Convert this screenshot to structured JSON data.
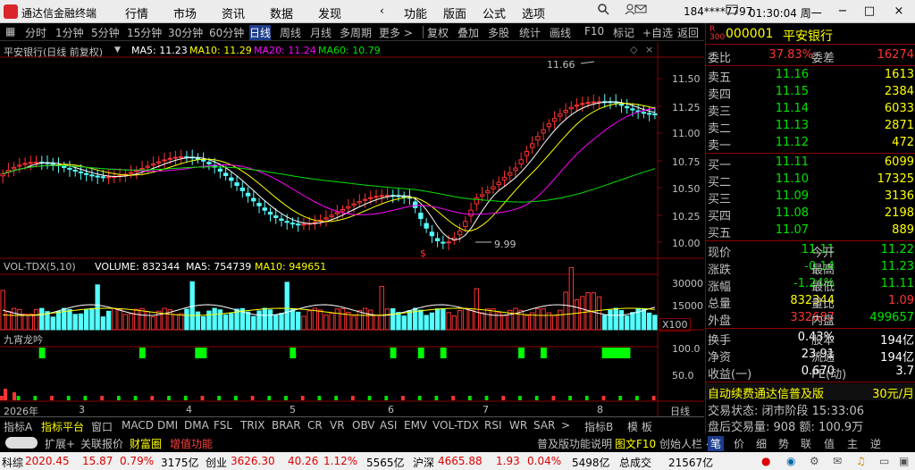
{
  "titlebar": {
    "app_name": "通达信金融终端",
    "menus": [
      "行情",
      "市场",
      "资讯",
      "数据",
      "发现",
      "功能",
      "版面",
      "公式",
      "选项"
    ],
    "account": "184****7797",
    "time": "01:30:04 周一",
    "back_arrow": "‹"
  },
  "toolbar": {
    "periods": [
      "分时",
      "1分钟",
      "5分钟",
      "15分钟",
      "30分钟",
      "60分钟",
      "日线",
      "周线",
      "月线",
      "多周期",
      "更多 >"
    ],
    "active": "日线",
    "right": [
      "复权",
      "叠加",
      "多股",
      "统计",
      "画线",
      "F10",
      "标记",
      "+自选",
      "返回"
    ]
  },
  "main_chart": {
    "header_name": "平安银行(日线 前复权)",
    "ma5": "MA5: 11.23",
    "ma10": "MA10: 11.29",
    "ma20": "MA20: 11.24",
    "ma60": "MA60: 10.79",
    "high_label": "11.66",
    "low_label": "9.99",
    "y_ticks": [
      "11.50",
      "11.25",
      "11.00",
      "10.75",
      "10.50",
      "10.25",
      "10.00"
    ]
  },
  "volume_chart": {
    "header": "VOL-TDX(5,10)",
    "volume": "VOLUME: 832344",
    "ma5": "MA5: 754739",
    "ma10": "MA10: 949651",
    "y_ticks": [
      "30000",
      "15000"
    ],
    "unit": "X100"
  },
  "indicator": {
    "name": "九宵龙吟",
    "y_ticks": [
      "100.0",
      "50.0"
    ]
  },
  "date_axis": {
    "year": "2026年",
    "months": [
      "3",
      "4",
      "5",
      "6",
      "7",
      "8"
    ],
    "period_label": "日线"
  },
  "bottom_tabs": [
    "指标A",
    "指标平台",
    "窗口",
    "MACD",
    "DMI",
    "DMA",
    "FSL",
    "TRIX",
    "BRAR",
    "CR",
    "VR",
    "OBV",
    "ASI",
    "EMV",
    "VOL-TDX",
    "RSI",
    "WR",
    "SAR",
    ">",
    "指标B",
    "模 板"
  ],
  "row2": {
    "left": [
      "扩展+",
      "关联报价",
      "财富圈",
      "增值功能"
    ],
    "right": [
      "普及版功能说明",
      "图文F10",
      "创始人栏 «"
    ],
    "icons": [
      "笔",
      "价",
      "细",
      "势",
      "联",
      "值",
      "主",
      "逆"
    ]
  },
  "quote": {
    "code": "000001",
    "name": "平安银行",
    "weibi_label": "委比",
    "weibi": "37.83%",
    "weicha_label": "委差",
    "weicha": "16274",
    "asks": [
      {
        "label": "卖五",
        "price": "11.16",
        "vol": "1613"
      },
      {
        "label": "卖四",
        "price": "11.15",
        "vol": "2384"
      },
      {
        "label": "卖三",
        "price": "11.14",
        "vol": "6033"
      },
      {
        "label": "卖二",
        "price": "11.13",
        "vol": "2871"
      },
      {
        "label": "卖一",
        "price": "11.12",
        "vol": "472"
      }
    ],
    "bids": [
      {
        "label": "买一",
        "price": "11.11",
        "vol": "6099"
      },
      {
        "label": "买二",
        "price": "11.10",
        "vol": "17325"
      },
      {
        "label": "买三",
        "price": "11.09",
        "vol": "3136"
      },
      {
        "label": "买四",
        "price": "11.08",
        "vol": "2198"
      },
      {
        "label": "买五",
        "price": "11.07",
        "vol": "889"
      }
    ],
    "stats": [
      {
        "l": "现价",
        "v": "11.11",
        "l2": "今开",
        "v2": "11.22"
      },
      {
        "l": "涨跌",
        "v": "-0.14",
        "l2": "最高",
        "v2": "11.23"
      },
      {
        "l": "涨幅",
        "v": "-1.24%",
        "l2": "最低",
        "v2": "11.11"
      },
      {
        "l": "总量",
        "v": "832344",
        "l2": "量比",
        "v2": "1.09"
      },
      {
        "l": "外盘",
        "v": "332687",
        "l2": "内盘",
        "v2": "499657"
      }
    ],
    "stats2": [
      {
        "l": "换手",
        "v": "0.43%",
        "l2": "股本",
        "v2": "194亿"
      },
      {
        "l": "净资",
        "v": "23.91",
        "l2": "流通",
        "v2": "194亿"
      },
      {
        "l": "收益(一)",
        "v": "0.670",
        "l2": "PE(动)",
        "v2": "3.7"
      }
    ],
    "ad_text": "自动续费通达信普及版",
    "ad_price": "30元/月",
    "trade_state": "交易状态: 闭市阶段 15:33:06",
    "after_hours": "盘后交易量: 908 额: 100.9万"
  },
  "status_bar": [
    {
      "name": "科综",
      "val": "2020.45",
      "chg": "15.87",
      "pct": "0.79%",
      "amt": "3175亿"
    },
    {
      "name": "创业",
      "val": "3626.30",
      "chg": "40.26",
      "pct": "1.12%",
      "amt": "5565亿"
    },
    {
      "name": "沪深",
      "val": "4665.88",
      "chg": "1.93",
      "pct": "0.04%",
      "amt": "5498亿"
    },
    {
      "name": "总成交",
      "val": "",
      "chg": "",
      "pct": "",
      "amt": "21567亿"
    }
  ],
  "colors": {
    "up": "#ff3232",
    "down": "#54ffff",
    "ma5": "#ffffff",
    "ma10": "#ffff00",
    "ma20": "#ff00ff",
    "ma60": "#00e400"
  }
}
